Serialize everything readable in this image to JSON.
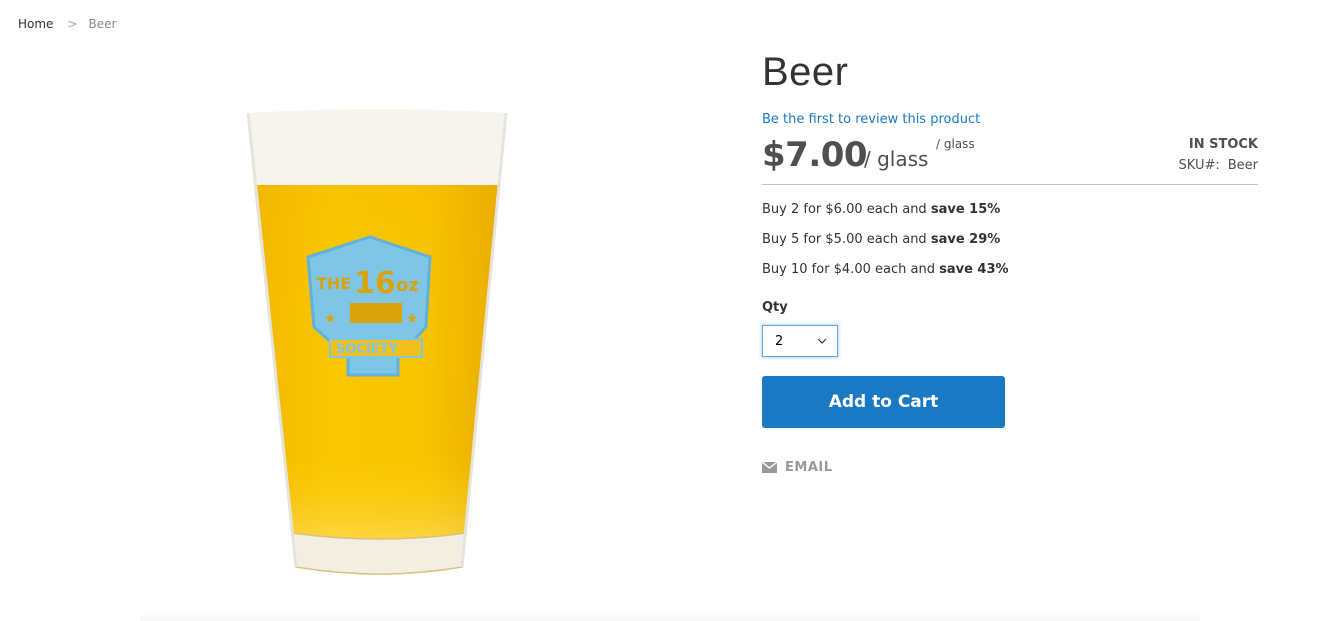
{
  "breadcrumb": {
    "items": [
      {
        "label": "Home"
      },
      {
        "label": "Beer"
      }
    ],
    "separator": ">"
  },
  "product": {
    "title": "Beer",
    "review_link": "Be the first to review this product",
    "price": "$7.00",
    "unit": "/ glass",
    "unit_superscript": "/ glass",
    "stock_status": "IN STOCK",
    "sku_label": "SKU#:",
    "sku_value": "Beer",
    "image_alt": "Pint glass of beer with The 16oz Society logo",
    "image_logo_text": [
      "THE",
      "16oz",
      "SOCIETY"
    ],
    "tier_prices": [
      {
        "text": "Buy 2 for $6.00 each and ",
        "save": "save 15%"
      },
      {
        "text": "Buy 5 for $5.00 each and ",
        "save": "save 29%"
      },
      {
        "text": "Buy 10 for $4.00 each and ",
        "save": "save 43%"
      }
    ]
  },
  "qty": {
    "label": "Qty",
    "selected": "2"
  },
  "actions": {
    "add_to_cart": "Add to Cart",
    "email": "EMAIL"
  },
  "colors": {
    "accent": "#1979c3",
    "text": "#333333",
    "muted": "#999999"
  }
}
